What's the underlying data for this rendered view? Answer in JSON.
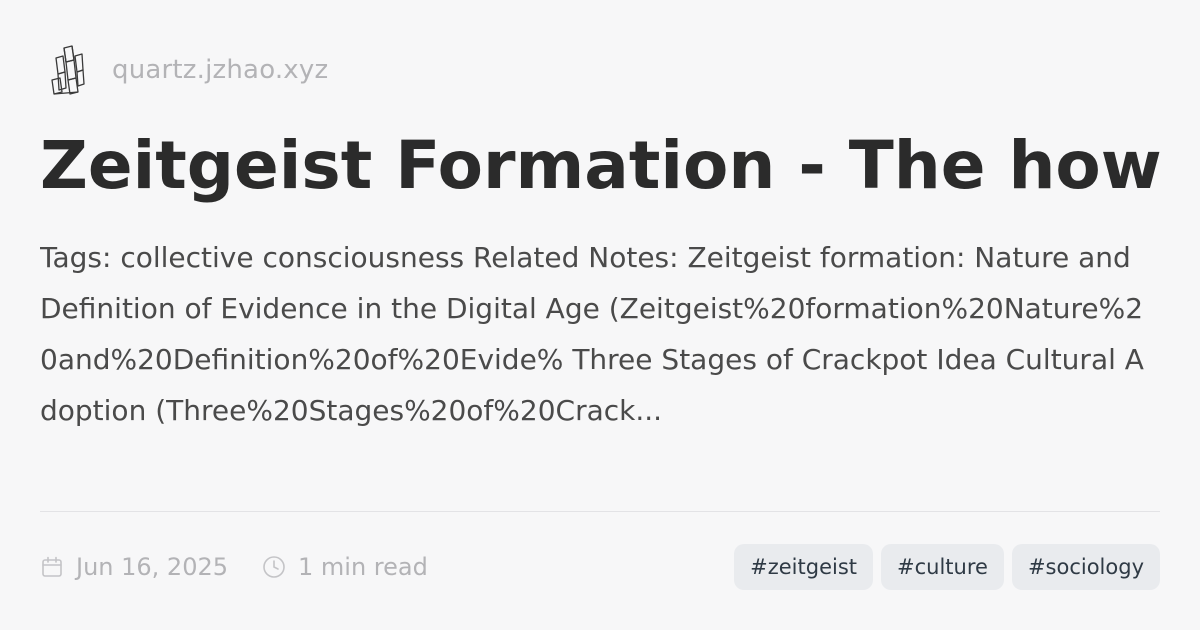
{
  "site": {
    "logo_icon": "crystal-icon",
    "domain": "quartz.jzhao.xyz"
  },
  "title": "Zeitgeist Formation - The how",
  "description": "Tags: collective consciousness Related Notes: Zeitgeist formation: Nature and Definition of Evidence in the Digital Age (Zeitgeist%20formation%20Nature%20and%20Definition%20of%20Evide% Three Stages of Crackpot Idea Cultural Adoption (Three%20Stages%20of%20Crack...",
  "meta": {
    "date_icon": "calendar-icon",
    "date": "Jun 16, 2025",
    "reading_icon": "clock-icon",
    "reading_time": "1 min read"
  },
  "tags": [
    "#zeitgeist",
    "#culture",
    "#sociology"
  ]
}
